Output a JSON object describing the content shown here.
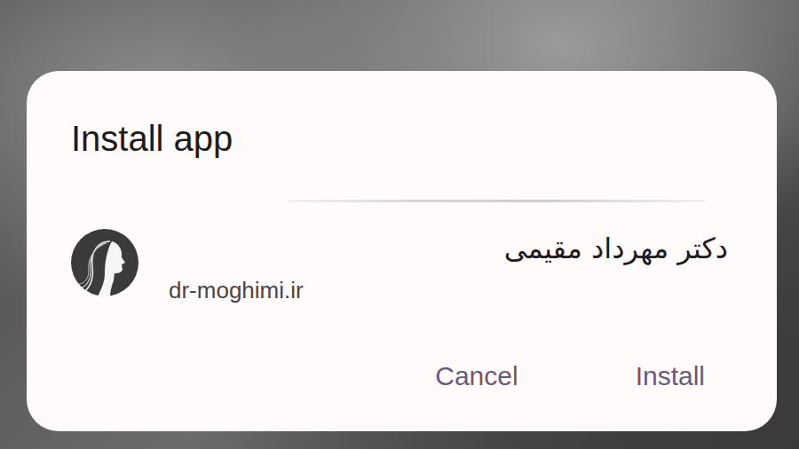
{
  "dialog": {
    "title": "Install app",
    "app_name": "دکتر مهرداد مقیمی",
    "app_url": "dr-moghimi.ir"
  },
  "buttons": [
    {
      "label": "Cancel"
    },
    {
      "label": "Install"
    }
  ]
}
